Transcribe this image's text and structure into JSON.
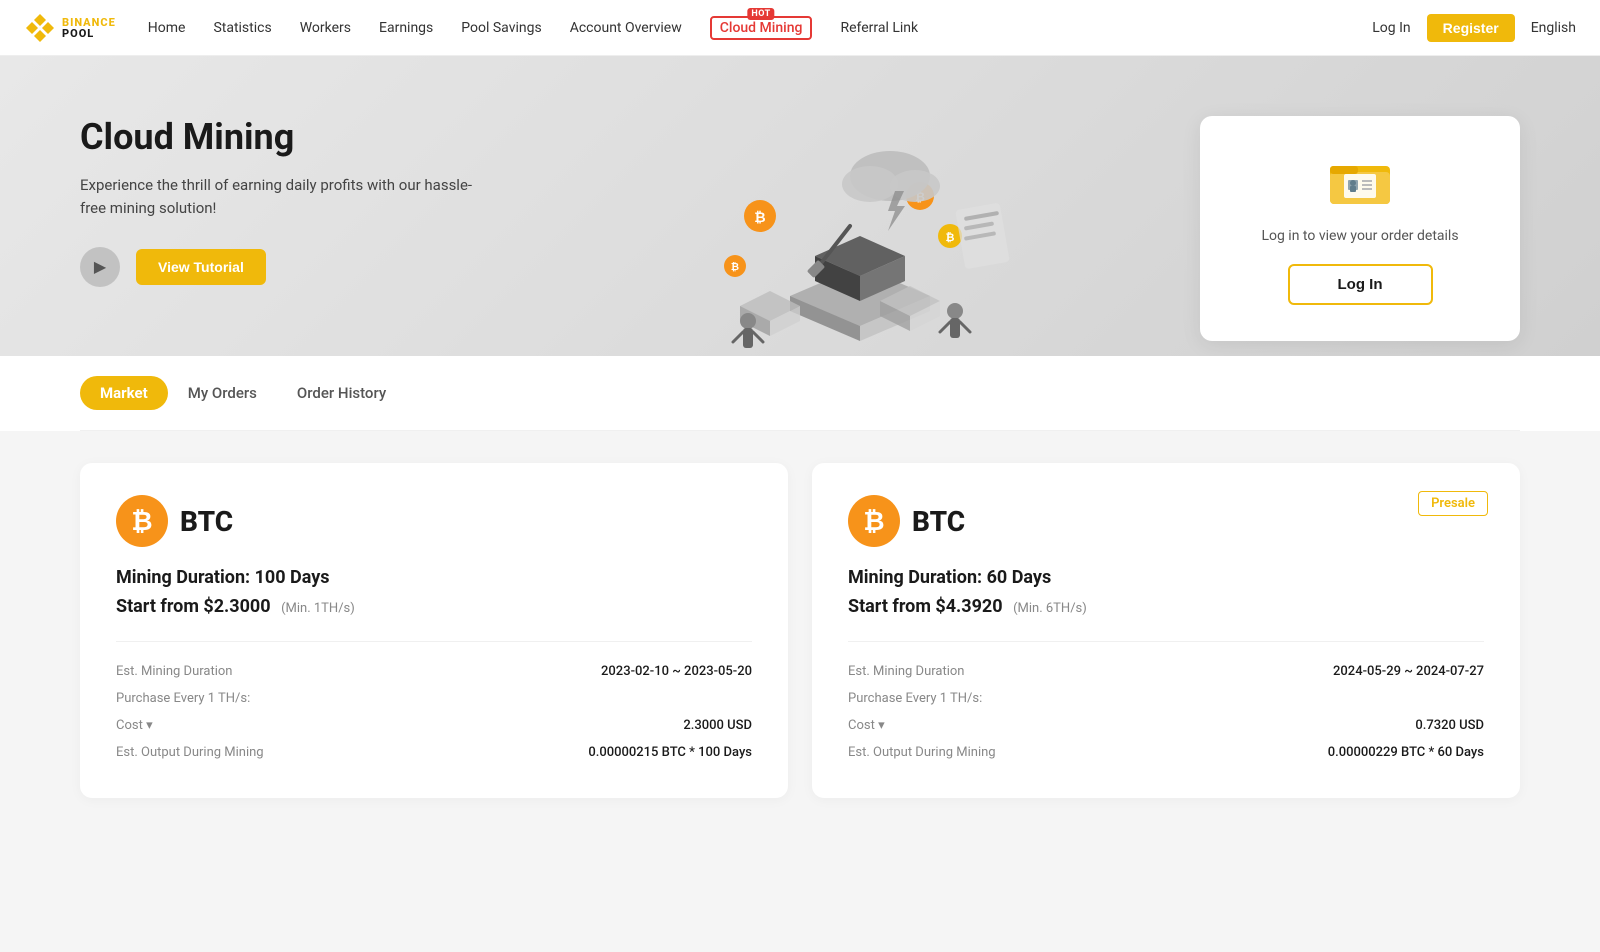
{
  "navbar": {
    "logo_top": "BINANCE",
    "logo_bot": "POOL",
    "links": [
      {
        "id": "home",
        "label": "Home",
        "active": false
      },
      {
        "id": "statistics",
        "label": "Statistics",
        "active": false
      },
      {
        "id": "workers",
        "label": "Workers",
        "active": false
      },
      {
        "id": "earnings",
        "label": "Earnings",
        "active": false
      },
      {
        "id": "pool-savings",
        "label": "Pool Savings",
        "active": false
      },
      {
        "id": "account-overview",
        "label": "Account Overview",
        "active": false
      },
      {
        "id": "cloud-mining",
        "label": "Cloud Mining",
        "active": true,
        "hot": true
      },
      {
        "id": "referral-link",
        "label": "Referral Link",
        "active": false
      }
    ],
    "login_label": "Log In",
    "register_label": "Register",
    "language": "English"
  },
  "hero": {
    "title": "Cloud Mining",
    "subtitle": "Experience the thrill of earning daily profits with our hassle-free mining solution!",
    "tutorial_btn": "View Tutorial",
    "card_text": "Log in to view your order details",
    "card_login_btn": "Log In"
  },
  "tabs": [
    {
      "id": "market",
      "label": "Market",
      "active": true
    },
    {
      "id": "my-orders",
      "label": "My Orders",
      "active": false
    },
    {
      "id": "order-history",
      "label": "Order History",
      "active": false
    }
  ],
  "mining_cards": [
    {
      "coin": "BTC",
      "symbol": "₿",
      "duration_label": "Mining Duration: 100 Days",
      "start_from_label": "Start from $2.3000",
      "min_label": "(Min. 1TH/s)",
      "presale": false,
      "details": [
        {
          "label": "Est. Mining Duration",
          "value": "2023-02-10 ~ 2023-05-20"
        },
        {
          "label": "Purchase Every 1 TH/s:",
          "value": ""
        },
        {
          "label": "Cost ▾",
          "value": "2.3000 USD"
        },
        {
          "label": "Est. Output During Mining",
          "value": "0.00000215 BTC * 100 Days"
        }
      ]
    },
    {
      "coin": "BTC",
      "symbol": "₿",
      "duration_label": "Mining Duration: 60 Days",
      "start_from_label": "Start from $4.3920",
      "min_label": "(Min. 6TH/s)",
      "presale": true,
      "presale_label": "Presale",
      "details": [
        {
          "label": "Est. Mining Duration",
          "value": "2024-05-29 ~ 2024-07-27"
        },
        {
          "label": "Purchase Every 1 TH/s:",
          "value": ""
        },
        {
          "label": "Cost ▾",
          "value": "0.7320 USD"
        },
        {
          "label": "Est. Output During Mining",
          "value": "0.00000229 BTC * 60 Days"
        }
      ]
    }
  ],
  "colors": {
    "accent": "#f0b90b",
    "hot_red": "#e53935",
    "btc_orange": "#f7931a"
  }
}
